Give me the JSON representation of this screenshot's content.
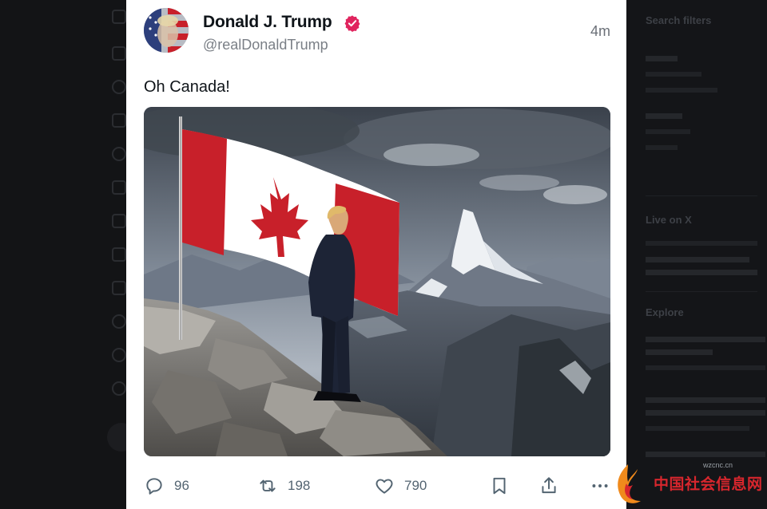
{
  "post": {
    "author": {
      "display_name": "Donald J. Trump",
      "handle": "@realDonaldTrump",
      "verified": true
    },
    "timestamp": "4m",
    "text": "Oh Canada!",
    "image_alt": "Man in suit standing on a rocky summit beside a Canadian flag with snowy mountains",
    "actions": {
      "reply_count": "96",
      "repost_count": "198",
      "like_count": "790"
    },
    "icons": [
      "reply-icon",
      "repost-icon",
      "like-icon",
      "bookmark-icon",
      "share-icon",
      "more-icon"
    ]
  },
  "sidebar": {
    "search_filters": "Search filters",
    "live_heading": "Live on X",
    "explore_heading": "Explore"
  },
  "watermark": {
    "text": "中国社会信息网",
    "sub": "wzcnc.cn"
  },
  "colors": {
    "flag_red": "#c8202a",
    "verified_pink": "#e0245e",
    "action_gray": "#536471"
  }
}
